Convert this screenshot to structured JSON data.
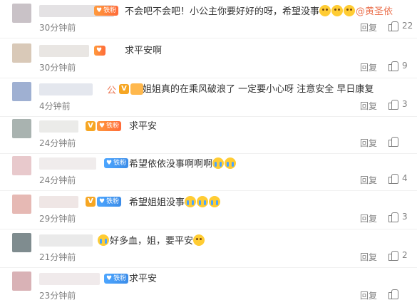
{
  "comments": [
    {
      "avatar_color": "#c9c2c7",
      "name_color": "#e4e2e4",
      "badges": [
        "fan-orange"
      ],
      "fan_label": "铁粉",
      "text": "不会吧不会吧！小公主你要好好的呀，希望没事",
      "emojis": [
        "sad",
        "sad",
        "sad"
      ],
      "mention": "@黄圣依",
      "time": "30分钟前",
      "reply": "回复",
      "likes": "22"
    },
    {
      "avatar_color": "#d9c9b8",
      "name_color": "#e9e6e3",
      "badges": [
        "fan-orange"
      ],
      "fan_label": "",
      "text": "求平安啊",
      "emojis": [],
      "mention": "",
      "time": "30分钟前",
      "reply": "回复",
      "likes": "9"
    },
    {
      "avatar_color": "#9fb0d2",
      "name_color": "#e4e7ee",
      "badges": [
        "name-tail",
        "vip",
        "loud"
      ],
      "name_tail": "公",
      "text": "姐姐真的在乘风破浪了 一定要小心呀 注意安全 早日康复",
      "emojis": [],
      "mention": "",
      "time": "4分钟前",
      "reply": "回复",
      "likes": "3"
    },
    {
      "avatar_color": "#a9b3b0",
      "name_color": "#ebebe9",
      "badges": [
        "vip",
        "fan-orange"
      ],
      "fan_label": "铁粉",
      "text": "求平安",
      "emojis": [],
      "mention": "",
      "time": "24分钟前",
      "reply": "回复",
      "likes": ""
    },
    {
      "avatar_color": "#e8c9cc",
      "name_color": "#f0ecec",
      "badges": [
        "fan-blue"
      ],
      "fan_label": "铁粉",
      "text": "希望依依没事啊啊啊",
      "emojis": [
        "cry",
        "cry"
      ],
      "mention": "",
      "time": "24分钟前",
      "reply": "回复",
      "likes": "4"
    },
    {
      "avatar_color": "#e6b9b4",
      "name_color": "#efe6e5",
      "badges": [
        "vip",
        "fan-blue"
      ],
      "fan_label": "铁粉",
      "text": "希望姐姐没事",
      "emojis": [
        "cry",
        "cry",
        "cry"
      ],
      "mention": "",
      "time": "29分钟前",
      "reply": "回复",
      "likes": "3"
    },
    {
      "avatar_color": "#7f8c8f",
      "name_color": "#eaeaea",
      "badges": [],
      "text": "好多血，姐，要平安",
      "emojis_before": [
        "cry"
      ],
      "emojis": [
        "sad"
      ],
      "mention": "",
      "time": "21分钟前",
      "reply": "回复",
      "likes": "2"
    },
    {
      "avatar_color": "#d9b2b6",
      "name_color": "#f0eaeb",
      "badges": [
        "fan-blue"
      ],
      "fan_label": "铁粉",
      "text": "求平安",
      "emojis": [],
      "mention": "",
      "time": "23分钟前",
      "reply": "回复",
      "likes": ""
    }
  ]
}
